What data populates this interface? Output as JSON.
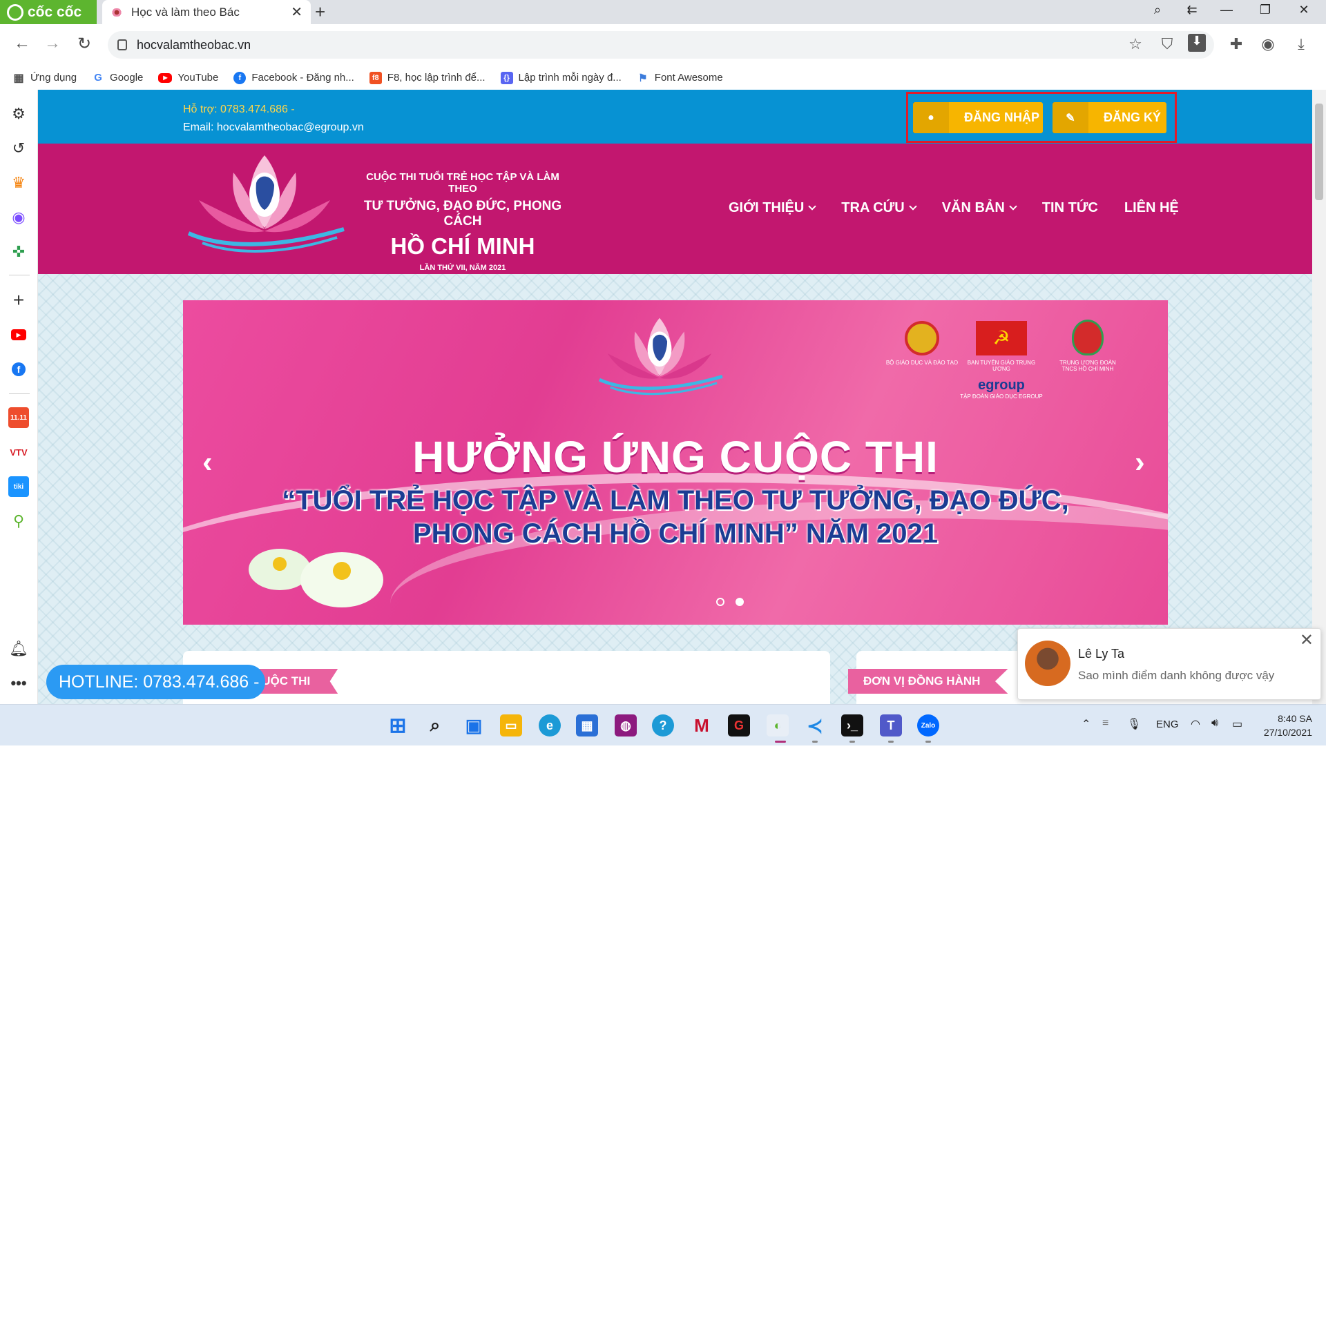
{
  "browser": {
    "brand": "cốc cốc",
    "tab_title": "Học và làm theo Bác",
    "url": "hocvalamtheobac.vn",
    "bookmarks": [
      {
        "label": "Ứng dụng",
        "icon": "apps-grid-icon"
      },
      {
        "label": "Google",
        "icon": "google-icon"
      },
      {
        "label": "YouTube",
        "icon": "youtube-icon"
      },
      {
        "label": "Facebook - Đăng nh...",
        "icon": "facebook-icon"
      },
      {
        "label": "F8, học lập trình để...",
        "icon": "f8-icon"
      },
      {
        "label": "Lập trình mỗi ngày đ...",
        "icon": "code-icon"
      },
      {
        "label": "Font Awesome",
        "icon": "flag-icon"
      }
    ]
  },
  "site": {
    "support_phone": "Hỗ trợ: 0783.474.686 -",
    "support_email": "Email: hocvalamtheobac@egroup.vn",
    "login_label": "ĐĂNG NHẬP",
    "register_label": "ĐĂNG KÝ",
    "title_line1": "CUỘC THI TUỔI TRẺ HỌC TẬP VÀ LÀM THEO",
    "title_line2": "TƯ TƯỞNG, ĐẠO ĐỨC, PHONG CÁCH",
    "title_line3": "HỒ CHÍ MINH",
    "title_line4": "LẦN THỨ VII, NĂM 2021",
    "nav": {
      "intro": "GIỚI THIỆU",
      "lookup": "TRA CỨU",
      "documents": "VĂN BẢN",
      "news": "TIN TỨC",
      "contact": "LIÊN HỆ"
    },
    "banner": {
      "headline": "HƯỞNG ỨNG CUỘC THI",
      "sub1": "“TUỔI TRẺ HỌC TẬP VÀ LÀM THEO TƯ TƯỞNG, ĐẠO ĐỨC,",
      "sub2": "PHONG CÁCH HỒ CHÍ MINH” NĂM 2021",
      "org1": "BỘ GIÁO DỤC VÀ ĐÀO TẠO",
      "org2": "BAN TUYÊN GIÁO TRUNG ƯƠNG",
      "org3": "TRUNG ƯƠNG ĐOÀN TNCS HỒ CHÍ MINH",
      "org4": "egroup",
      "org4_sub": "TẬP ĐOÀN GIÁO DỤC EGROUP",
      "active_slide": 2,
      "slide_count": 2
    },
    "section_left": "CUỘC THI",
    "section_right": "ĐƠN VỊ ĐỒNG HÀNH",
    "hotline": "HOTLINE: 0783.474.686 -"
  },
  "chat": {
    "name": "Lê Ly Ta",
    "message": "Sao mình điểm danh không được vậy"
  },
  "taskbar": {
    "lang": "ENG",
    "time": "8:40 SA",
    "date": "27/10/2021"
  },
  "colors": {
    "topbar": "#0792d3",
    "header": "#c2176f",
    "auth_button": "#f7b500",
    "highlight_box": "#e01b2a",
    "hotline": "#2b9af3"
  }
}
